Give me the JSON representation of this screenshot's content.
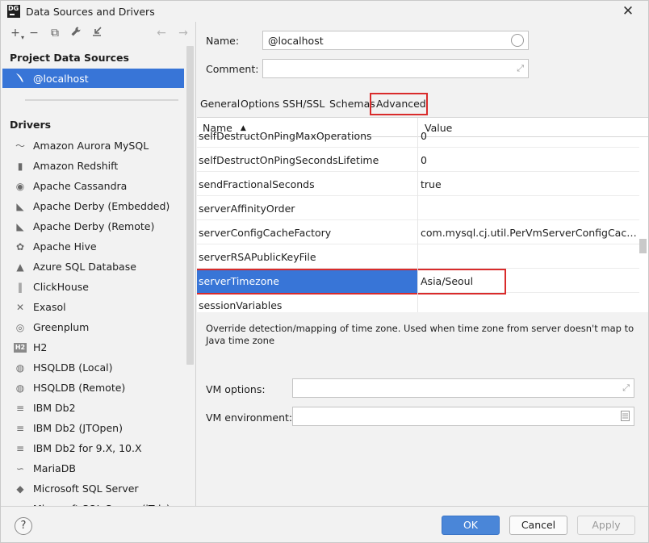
{
  "window": {
    "title": "Data Sources and Drivers",
    "app_icon_text": "DG"
  },
  "toolbar": {
    "add_label": "+",
    "remove_label": "−",
    "duplicate_label": "⧉",
    "settings_label": "🔧",
    "import_label": "↙",
    "back_label": "←",
    "forward_label": "→"
  },
  "sidebar": {
    "project_title": "Project Data Sources",
    "selected_source": "@localhost",
    "drivers_title": "Drivers",
    "drivers": [
      {
        "label": "Amazon Aurora MySQL",
        "icon": "dolphin-icon"
      },
      {
        "label": "Amazon Redshift",
        "icon": "redshift-icon"
      },
      {
        "label": "Apache Cassandra",
        "icon": "cassandra-icon"
      },
      {
        "label": "Apache Derby (Embedded)",
        "icon": "derby-icon"
      },
      {
        "label": "Apache Derby (Remote)",
        "icon": "derby-icon"
      },
      {
        "label": "Apache Hive",
        "icon": "hive-icon"
      },
      {
        "label": "Azure SQL Database",
        "icon": "azure-icon"
      },
      {
        "label": "ClickHouse",
        "icon": "clickhouse-icon"
      },
      {
        "label": "Exasol",
        "icon": "exasol-icon"
      },
      {
        "label": "Greenplum",
        "icon": "greenplum-icon"
      },
      {
        "label": "H2",
        "icon": "h2-icon"
      },
      {
        "label": "HSQLDB (Local)",
        "icon": "hsqldb-icon"
      },
      {
        "label": "HSQLDB (Remote)",
        "icon": "hsqldb-icon"
      },
      {
        "label": "IBM Db2",
        "icon": "ibm-icon"
      },
      {
        "label": "IBM Db2 (JTOpen)",
        "icon": "ibm-icon"
      },
      {
        "label": "IBM Db2 for 9.X, 10.X",
        "icon": "ibm-icon"
      },
      {
        "label": "MariaDB",
        "icon": "mariadb-icon"
      },
      {
        "label": "Microsoft SQL Server",
        "icon": "sqlserver-icon"
      },
      {
        "label": "Microsoft SQL Server (jTds)",
        "icon": "sqlserver-icon"
      }
    ]
  },
  "form": {
    "name_label": "Name:",
    "name_value": "@localhost",
    "comment_label": "Comment:",
    "comment_value": ""
  },
  "tabs": [
    "General",
    "Options",
    "SSH/SSL",
    "Schemas",
    "Advanced"
  ],
  "active_tab": "Advanced",
  "table": {
    "col_name": "Name",
    "col_value": "Value",
    "rows": [
      {
        "name": "selfDestructOnPingMaxOperations",
        "value": "0"
      },
      {
        "name": "selfDestructOnPingSecondsLifetime",
        "value": "0"
      },
      {
        "name": "sendFractionalSeconds",
        "value": "true"
      },
      {
        "name": "serverAffinityOrder",
        "value": ""
      },
      {
        "name": "serverConfigCacheFactory",
        "value": "com.mysql.cj.util.PerVmServerConfigCacheFactory"
      },
      {
        "name": "serverRSAPublicKeyFile",
        "value": ""
      },
      {
        "name": "serverTimezone",
        "value": "Asia/Seoul",
        "selected": true
      },
      {
        "name": "sessionVariables",
        "value": ""
      }
    ]
  },
  "description": "Override detection/mapping of time zone. Used when time zone from server doesn't map to Java time zone",
  "vm": {
    "options_label": "VM options:",
    "options_value": "",
    "environment_label": "VM environment:",
    "environment_value": ""
  },
  "buttons": {
    "help": "?",
    "ok": "OK",
    "cancel": "Cancel",
    "apply": "Apply"
  },
  "colors": {
    "selection": "#3875d7",
    "highlight_border": "#d92b2b",
    "ok_button": "#4a86d8"
  }
}
